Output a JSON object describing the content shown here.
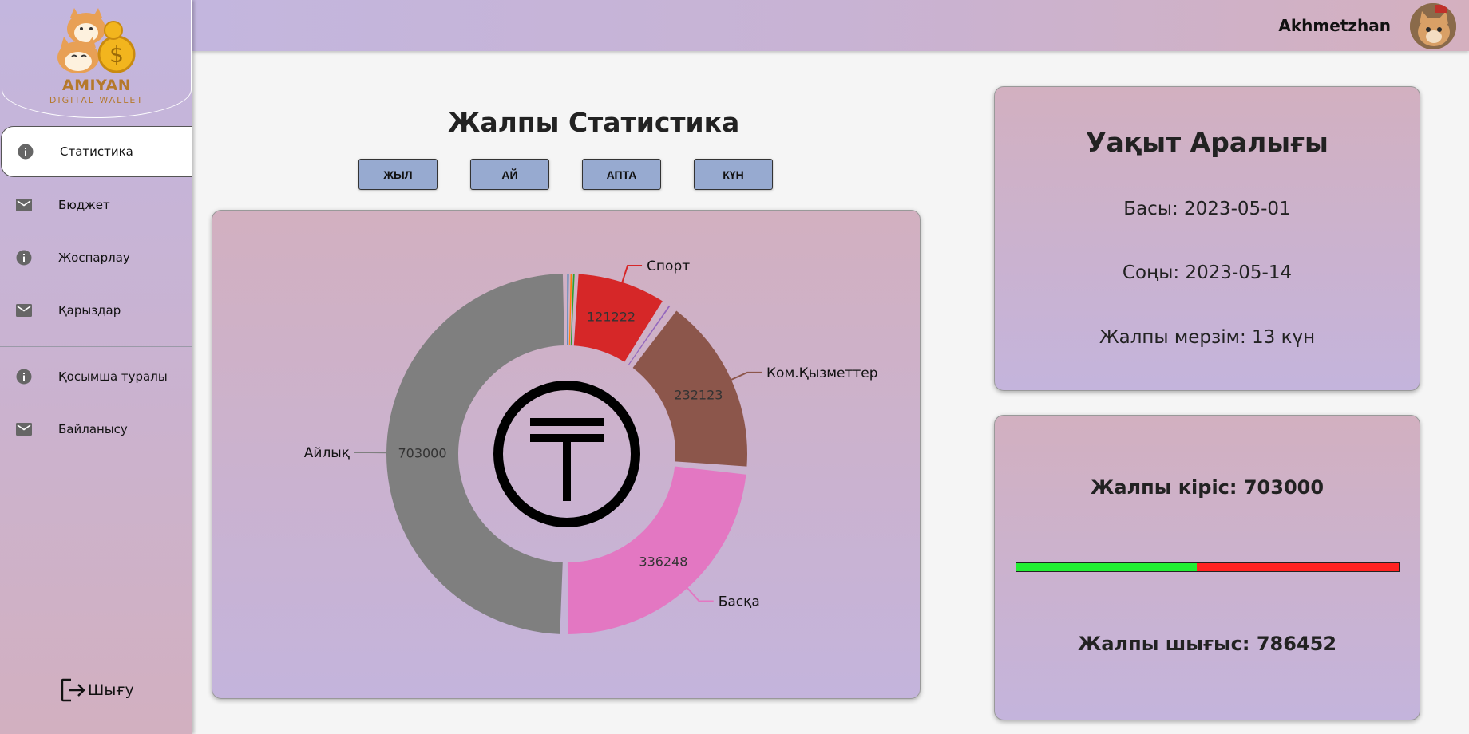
{
  "brand": {
    "name": "AMIYAN",
    "subtitle": "DIGITAL WALLET"
  },
  "user": {
    "name": "Akhmetzhan"
  },
  "sidebar": {
    "items": [
      {
        "label": "Статистика",
        "icon": "info-icon",
        "active": true
      },
      {
        "label": "Бюджет",
        "icon": "mail-icon"
      },
      {
        "label": "Жоспарлау",
        "icon": "info-icon"
      },
      {
        "label": "Қарыздар",
        "icon": "mail-icon"
      },
      {
        "label": "Қосымша туралы",
        "icon": "info-icon"
      },
      {
        "label": "Байланысу",
        "icon": "mail-icon"
      }
    ],
    "logout_label": "Шығу"
  },
  "main": {
    "title": "Жалпы Статистика",
    "periods": [
      "ЖЫЛ",
      "АЙ",
      "АПТА",
      "КҮН"
    ]
  },
  "chart_data": {
    "type": "pie",
    "style": "donut",
    "center_icon": "tenge-icon",
    "slices": [
      {
        "label": "",
        "value": 3000,
        "color": "#1f77b4"
      },
      {
        "label": "",
        "value": 5000,
        "color": "#ff7f0e"
      },
      {
        "label": "",
        "value": 1500,
        "color": "#2ca02c"
      },
      {
        "label": "Спорт",
        "value": 121222,
        "color": "#d62728"
      },
      {
        "label": "",
        "value": 11000,
        "color": "#9467bd"
      },
      {
        "label": "Ком.Қызметтер",
        "value": 232123,
        "color": "#8c564b"
      },
      {
        "label": "Басқа",
        "value": 336248,
        "color": "#e377c2"
      },
      {
        "label": "Айлық",
        "value": 703000,
        "color": "#7f7f7f"
      }
    ]
  },
  "period_card": {
    "title": "Уақыт Аралығы",
    "start": "Басы: 2023-05-01",
    "end": "Соңы: 2023-05-14",
    "total": "Жалпы мерзім: 13 күн"
  },
  "totals_card": {
    "income": "Жалпы кіріс: 703000",
    "expense": "Жалпы шығыс: 786452",
    "income_share": 0.472,
    "income_color": "#22ee33",
    "expense_color": "#ff2222"
  }
}
